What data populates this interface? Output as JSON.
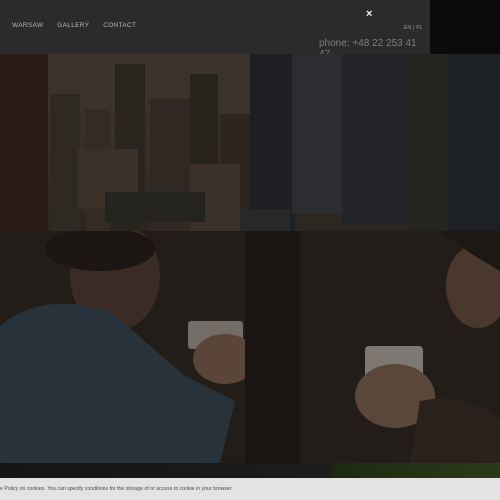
{
  "nav": {
    "items": [
      "WARSAW",
      "GALLERY",
      "CONTACT"
    ]
  },
  "close_glyph": "×",
  "lang": {
    "en": "EN",
    "sep": "|",
    "pl": "PL"
  },
  "phone": "phone: +48 22 253 41 47",
  "cookie": {
    "text": "e Policy on cookies. You can specify conditions for the storage of or access to cookie in your browser."
  }
}
